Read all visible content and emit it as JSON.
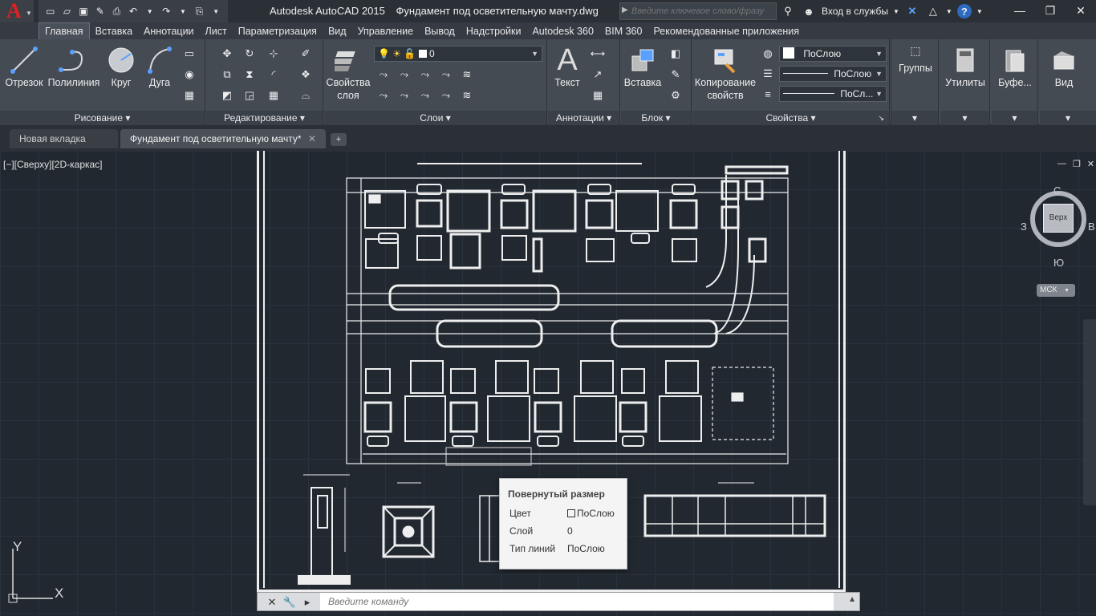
{
  "app": {
    "title": "Autodesk AutoCAD 2015",
    "document": "Фундамент под осветительную мачту.dwg"
  },
  "search": {
    "placeholder": "Введите ключевое слово/фразу"
  },
  "account": {
    "signin": "Вход в службы"
  },
  "ribbon_tabs": [
    "Главная",
    "Вставка",
    "Аннотации",
    "Лист",
    "Параметризация",
    "Вид",
    "Управление",
    "Вывод",
    "Надстройки",
    "Autodesk 360",
    "BIM 360",
    "Рекомендованные приложения"
  ],
  "ribbon": {
    "draw": {
      "title": "Рисование",
      "line": "Отрезок",
      "polyline": "Полилиния",
      "circle": "Круг",
      "arc": "Дуга"
    },
    "modify": {
      "title": "Редактирование"
    },
    "layers": {
      "title": "Слои",
      "properties": "Свойства",
      "properties2": "слоя",
      "current_layer": "0"
    },
    "annotation": {
      "title": "Аннотации",
      "text": "Текст"
    },
    "block": {
      "title": "Блок",
      "insert": "Вставка"
    },
    "properties": {
      "title": "Свойства",
      "match": "Копирование",
      "match2": "свойств",
      "color": "ПоСлою",
      "linetype": "ПоСлою",
      "lineweight": "ПоСл..."
    },
    "groups": {
      "label": "Группы"
    },
    "utilities": {
      "label": "Утилиты"
    },
    "clipboard": {
      "label": "Буфе..."
    },
    "view": {
      "label": "Вид"
    }
  },
  "doc_tabs": {
    "new_tab": "Новая вкладка",
    "current": "Фундамент под осветительную мачту*"
  },
  "viewport": {
    "label": "[−][Сверху][2D-каркас]",
    "viewcube": {
      "face": "Верх",
      "north": "С",
      "south": "Ю",
      "west": "З",
      "east": "В"
    },
    "ucs_menu": "МСК",
    "axis_y": "Y",
    "axis_x": "X"
  },
  "tooltip": {
    "title": "Повернутый размер",
    "rows": [
      {
        "label": "Цвет",
        "value": "ПоСлою"
      },
      {
        "label": "Слой",
        "value": "0"
      },
      {
        "label": "Тип линий",
        "value": "ПоСлою"
      }
    ]
  },
  "command": {
    "placeholder": "Введите команду"
  },
  "colors": {
    "accent": "#d22222",
    "ribbon": "#444b53",
    "canvas": "#212830"
  }
}
